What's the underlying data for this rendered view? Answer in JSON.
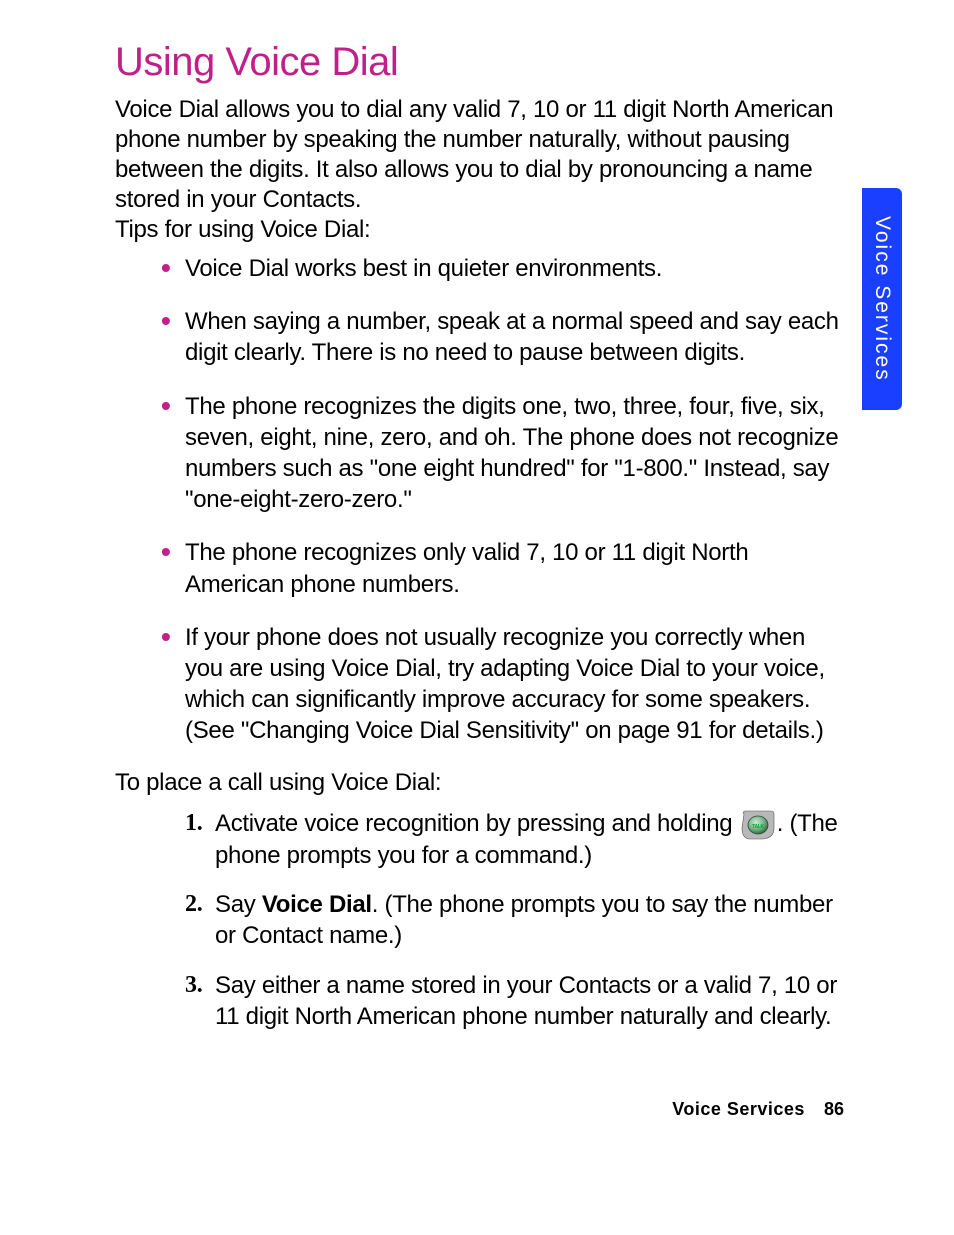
{
  "heading": "Using Voice Dial",
  "intro": "Voice Dial allows you to dial any valid 7, 10 or 11 digit North American phone number by speaking the number naturally, without pausing between the digits. It also allows you to dial by pronouncing a name stored in your Contacts.",
  "tips_label": "Tips for using Voice Dial:",
  "tips": [
    "Voice Dial works best in quieter environments.",
    "When saying a number, speak at a normal speed and say each digit clearly. There is no need to pause between digits.",
    "The phone recognizes the digits one, two, three, four, five, six, seven, eight, nine, zero, and oh. The phone does not recognize numbers such as \"one eight hundred\" for \"1-800.\" Instead, say \"one-eight-zero-zero.\"",
    "The phone recognizes only valid 7, 10 or 11 digit North American phone numbers.",
    "If your phone does not usually recognize you correctly when you are using Voice Dial, try adapting Voice Dial to your voice, which can significantly improve accuracy for some speakers. (See \"Changing Voice Dial Sensitivity\" on page 91 for details.)"
  ],
  "steps_label": "To place a call using Voice Dial:",
  "step1_before": "Activate voice recognition by pressing and holding ",
  "step1_after": ". (The phone prompts you for a command.)",
  "step2_before": "Say ",
  "step2_bold": "Voice Dial",
  "step2_after": ". (The phone prompts you to say the number or Contact name.)",
  "step3": "Say either a name stored in your Contacts or a valid 7, 10 or 11 digit North American phone number naturally and clearly.",
  "side_tab": "Voice Services",
  "footer_section": "Voice Services",
  "footer_page": "86",
  "icons": {
    "talk_key": "talk-key"
  }
}
